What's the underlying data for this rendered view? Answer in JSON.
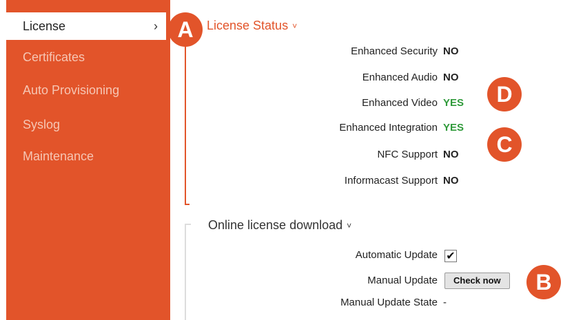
{
  "sidebar": {
    "items": [
      {
        "label": "License",
        "chevron": "›"
      },
      {
        "label": "Certificates"
      },
      {
        "label": "Auto Provisioning"
      },
      {
        "label": "Syslog"
      },
      {
        "label": "Maintenance"
      }
    ]
  },
  "license_status": {
    "title": "License Status",
    "caret": "˅",
    "rows": [
      {
        "label": "Enhanced Security",
        "value": "NO"
      },
      {
        "label": "Enhanced Audio",
        "value": "NO"
      },
      {
        "label": "Enhanced Video",
        "value": "YES"
      },
      {
        "label": "Enhanced Integration",
        "value": "YES"
      },
      {
        "label": "NFC Support",
        "value": "NO"
      },
      {
        "label": "Informacast Support",
        "value": "NO"
      }
    ]
  },
  "online_download": {
    "title": "Online license download",
    "caret": "˅",
    "automatic_update_label": "Automatic Update",
    "automatic_update_checked": true,
    "check_glyph": "✔",
    "manual_update_label": "Manual Update",
    "check_now_label": "Check now",
    "manual_update_state_label": "Manual Update State",
    "manual_update_state_value": "-"
  },
  "badges": {
    "a": "A",
    "b": "B",
    "c": "C",
    "d": "D"
  },
  "colors": {
    "accent": "#e2542a",
    "yes": "#2f9a3a",
    "sidebar_text": "#f6c6b4"
  }
}
